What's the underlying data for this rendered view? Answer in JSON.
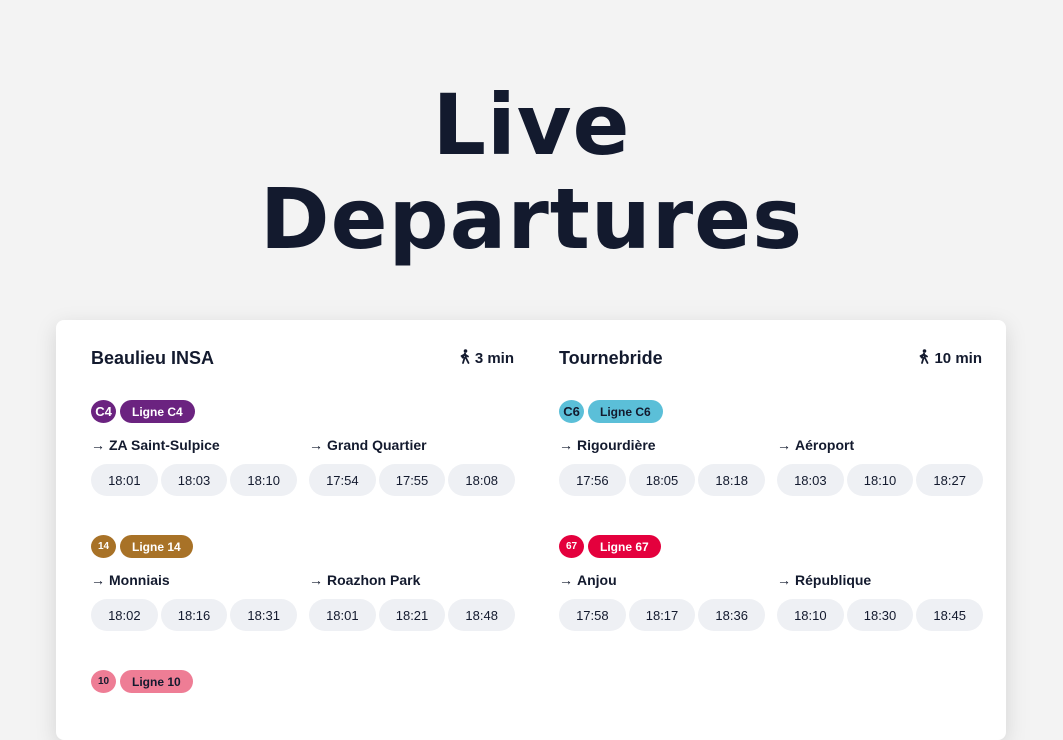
{
  "page": {
    "title_line1": "Live",
    "title_line2": "Departures"
  },
  "stops": [
    {
      "name": "Beaulieu INSA",
      "walk_icon": "walking-person-icon",
      "walk_time": "3 min",
      "lines": [
        {
          "badge": "C4",
          "label": "Ligne C4",
          "color": "#6b2380",
          "text_color": "#ffffff",
          "directions": [
            {
              "dest": "ZA Saint-Sulpice",
              "times": [
                "18:01",
                "18:03",
                "18:10"
              ]
            },
            {
              "dest": "Grand Quartier",
              "times": [
                "17:54",
                "17:55",
                "18:08"
              ]
            }
          ]
        },
        {
          "badge": "14",
          "label": "Ligne 14",
          "color": "#a87227",
          "text_color": "#ffffff",
          "directions": [
            {
              "dest": "Monniais",
              "times": [
                "18:02",
                "18:16",
                "18:31"
              ]
            },
            {
              "dest": "Roazhon Park",
              "times": [
                "18:01",
                "18:21",
                "18:48"
              ]
            }
          ]
        },
        {
          "badge": "10",
          "label": "Ligne 10",
          "color": "#ee7d95",
          "text_color": "#131a2e"
        }
      ]
    },
    {
      "name": "Tournebride",
      "walk_icon": "walking-person-icon",
      "walk_time": "10 min",
      "lines": [
        {
          "badge": "C6",
          "label": "Ligne C6",
          "color": "#5bbfd8",
          "text_color": "#131a2e",
          "directions": [
            {
              "dest": "Rigourdière",
              "times": [
                "17:56",
                "18:05",
                "18:18"
              ]
            },
            {
              "dest": "Aéroport",
              "times": [
                "18:03",
                "18:10",
                "18:27"
              ]
            }
          ]
        },
        {
          "badge": "67",
          "label": "Ligne 67",
          "color": "#e4003d",
          "text_color": "#ffffff",
          "directions": [
            {
              "dest": "Anjou",
              "times": [
                "17:58",
                "18:17",
                "18:36"
              ]
            },
            {
              "dest": "République",
              "times": [
                "18:10",
                "18:30",
                "18:45"
              ]
            }
          ]
        }
      ]
    }
  ],
  "direction_arrow": "→"
}
